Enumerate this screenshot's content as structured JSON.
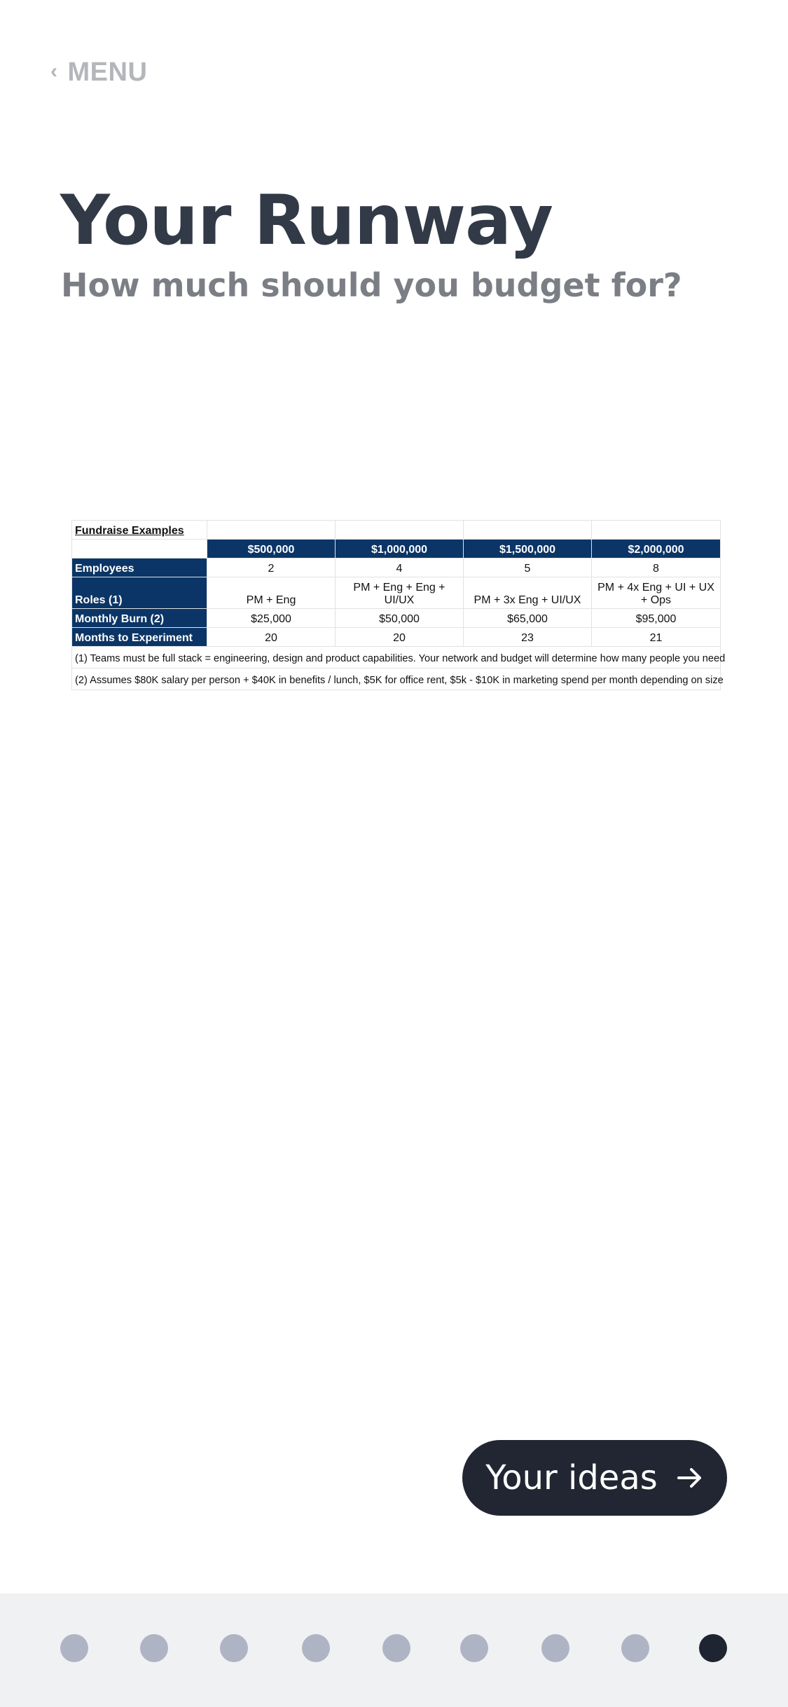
{
  "header": {
    "back_label": "MENU"
  },
  "page": {
    "title": "Your Runway",
    "subtitle": "How much should you budget for?"
  },
  "table": {
    "caption": "Fundraise Examples",
    "columns": [
      "$500,000",
      "$1,000,000",
      "$1,500,000",
      "$2,000,000"
    ],
    "rows": [
      {
        "label": "Employees",
        "values": [
          "2",
          "4",
          "5",
          "8"
        ]
      },
      {
        "label": "Roles (1)",
        "values": [
          "PM + Eng",
          "PM + Eng + Eng + UI/UX",
          "PM + 3x Eng + UI/UX",
          "PM + 4x Eng + UI + UX + Ops"
        ]
      },
      {
        "label": "Monthly Burn (2)",
        "values": [
          "$25,000",
          "$50,000",
          "$65,000",
          "$95,000"
        ]
      },
      {
        "label": "Months to Experiment",
        "values": [
          "20",
          "20",
          "23",
          "21"
        ]
      }
    ],
    "notes": [
      "(1) Teams must be full stack = engineering, design and product capabilities.  Your network and budget will determine how many people you need",
      "(2) Assumes $80K salary per person + $40K in benefits / lunch, $5K for office rent, $5k - $10K in marketing spend per month depending on size"
    ],
    "colors": {
      "header_bg": "#0b3566",
      "header_text": "#ffffff"
    }
  },
  "next_button": {
    "label": "Your ideas",
    "icon": "arrow-right-icon"
  },
  "pagination": {
    "total": 9,
    "current": 9
  },
  "colors": {
    "title": "#323a47",
    "subtitle": "#7b7e84",
    "button_bg": "#212632",
    "dot_inactive": "#aeb4c3",
    "dot_active": "#1f2432"
  }
}
